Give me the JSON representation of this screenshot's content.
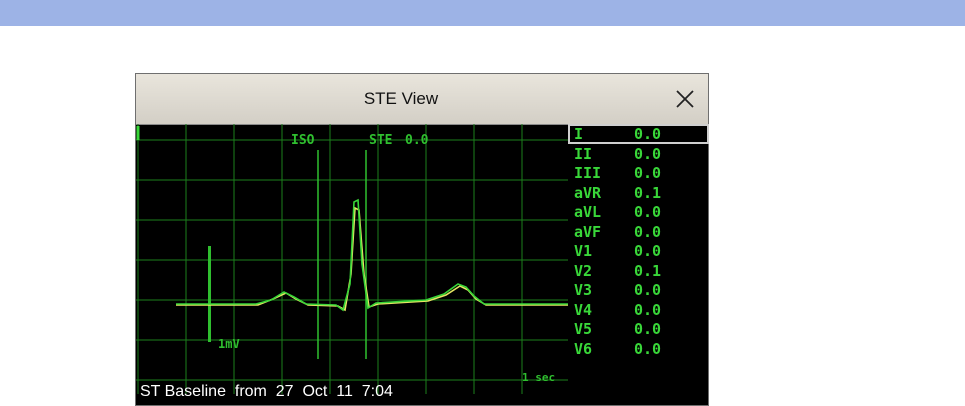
{
  "window": {
    "title": "STE View"
  },
  "ecg": {
    "lead_label": "I",
    "iso_label": "ISO",
    "ste_label": "STE",
    "ste_value": "0.0",
    "calibration_label": "1mV",
    "time_scale_label": "1 sec",
    "baseline_text": "ST Baseline  from  27  Oct  11  7:04",
    "colors": {
      "grid": "#1c7f1c",
      "trace_current": "#38d638",
      "trace_baseline": "#e6e662",
      "marker": "#2fbf2f"
    }
  },
  "leads": [
    {
      "name": "I",
      "value": "0.0",
      "selected": true
    },
    {
      "name": "II",
      "value": "0.0"
    },
    {
      "name": "III",
      "value": "0.0"
    },
    {
      "name": "aVR",
      "value": "0.1"
    },
    {
      "name": "aVL",
      "value": "0.0"
    },
    {
      "name": "aVF",
      "value": "0.0"
    },
    {
      "name": "V1",
      "value": "0.0"
    },
    {
      "name": "V2",
      "value": "0.1"
    },
    {
      "name": "V3",
      "value": "0.0"
    },
    {
      "name": "V4",
      "value": "0.0"
    },
    {
      "name": "V5",
      "value": "0.0"
    },
    {
      "name": "V6",
      "value": "0.0"
    }
  ]
}
